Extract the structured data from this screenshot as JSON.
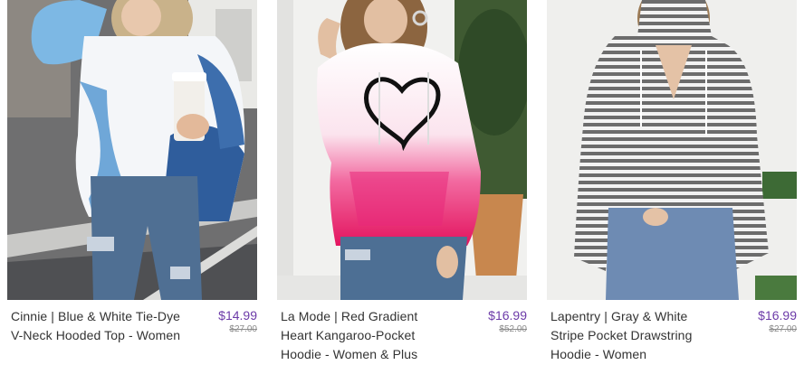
{
  "products": [
    {
      "title": "Cinnie | Blue & White Tie-Dye V-Neck Hooded Top - Women",
      "price": "$14.99",
      "original_price": "$27.00",
      "image_alt": "Blue and white tie-dye v-neck hoodie"
    },
    {
      "title": "La Mode | Red Gradient Heart Kangaroo-Pocket Hoodie - Women & Plus",
      "price": "$16.99",
      "original_price": "$52.00",
      "image_alt": "Red gradient heart kangaroo-pocket hoodie"
    },
    {
      "title": "Lapentry | Gray & White Stripe Pocket Drawstring Hoodie - Women",
      "price": "$16.99",
      "original_price": "$27.00",
      "image_alt": "Gray and white stripe drawstring hoodie"
    }
  ],
  "colors": {
    "price": "#6c3aa8",
    "original_price": "#8a8a8a",
    "title": "#333333"
  }
}
